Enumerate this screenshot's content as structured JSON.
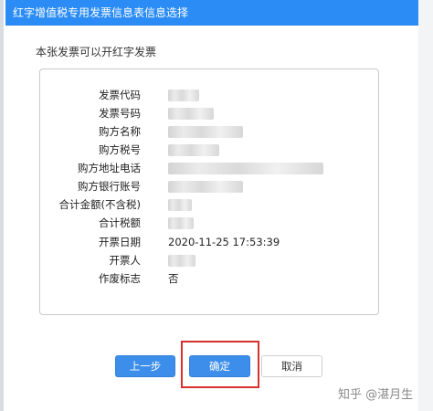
{
  "window": {
    "title": "红字增值税专用发票信息表信息选择"
  },
  "notice": "本张发票可以开红字发票",
  "invoice_fields": [
    {
      "label": "发票代码",
      "value": ""
    },
    {
      "label": "发票号码",
      "value": ""
    },
    {
      "label": "购方名称",
      "value": ""
    },
    {
      "label": "购方税号",
      "value": ""
    },
    {
      "label": "购方地址电话",
      "value": ""
    },
    {
      "label": "购方银行账号",
      "value": ""
    },
    {
      "label": "合计金额(不含税)",
      "value": ""
    },
    {
      "label": "合计税额",
      "value": ""
    },
    {
      "label": "开票日期",
      "value": "2020-11-25 17:53:39"
    },
    {
      "label": "开票人",
      "value": ""
    },
    {
      "label": "作废标志",
      "value": "否"
    }
  ],
  "buttons": {
    "prev_label": "上一步",
    "confirm_label": "确定",
    "cancel_label": "取消"
  },
  "watermark": "知乎 @湛月生",
  "colors": {
    "title_bar": "#2b8cf5",
    "primary_button": "#3d8eea",
    "highlight_box": "#d7302e"
  }
}
